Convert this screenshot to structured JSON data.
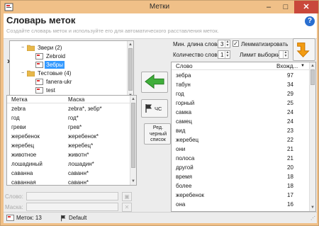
{
  "window": {
    "title": "Метки"
  },
  "header": {
    "title": "Словарь меток",
    "subtitle": "Создайте словарь меток и используйте его для автоматического расставления меток."
  },
  "tree": {
    "items": [
      {
        "label": "Звери (2)",
        "expander": "−"
      },
      {
        "label": "Zebroid"
      },
      {
        "label": "Зебры"
      },
      {
        "label": "Тестовые (4)",
        "expander": "−"
      },
      {
        "label": "fanera-ukr"
      },
      {
        "label": "test"
      }
    ]
  },
  "tags_table": {
    "headers": [
      "Метка",
      "Маска"
    ],
    "rows": [
      [
        "zebra",
        "zebra*, зебр*"
      ],
      [
        "год",
        "год*"
      ],
      [
        "греви",
        "грев*"
      ],
      [
        "жеребенок",
        "жеребенок*"
      ],
      [
        "жеребец",
        "жеребец*"
      ],
      [
        "животное",
        "животн*"
      ],
      [
        "лошадиный",
        "лошадин*"
      ],
      [
        "саванна",
        "саванн*"
      ],
      [
        "саванная",
        "саванн*"
      ]
    ]
  },
  "edit": {
    "word_label": "Слово:",
    "mask_label": "Маска:"
  },
  "buttons": {
    "add_arrow_icon": "arrow-left-green",
    "stop_label": "ЧС",
    "blacklist_label": "Ред. черный список"
  },
  "options": {
    "min_length_label": "Мин. длина слова:",
    "min_length_value": "3",
    "lemmatize_label": "Лемматизировать",
    "lemmatize_checked": true,
    "word_count_label": "Количество слов:",
    "word_count_value": "1",
    "limit_label": "Лимит выборки:",
    "limit_value": ""
  },
  "words_table": {
    "headers": [
      "Слово",
      "Вхожд..."
    ],
    "rows": [
      [
        "зебра",
        "97"
      ],
      [
        "табун",
        "34"
      ],
      [
        "год",
        "29"
      ],
      [
        "горный",
        "25"
      ],
      [
        "самка",
        "24"
      ],
      [
        "самец",
        "24"
      ],
      [
        "вид",
        "23"
      ],
      [
        "жеребец",
        "22"
      ],
      [
        "они",
        "21"
      ],
      [
        "полоса",
        "21"
      ],
      [
        "другой",
        "20"
      ],
      [
        "время",
        "18"
      ],
      [
        "более",
        "18"
      ],
      [
        "жеребенок",
        "17"
      ],
      [
        "она",
        "16"
      ]
    ]
  },
  "status": {
    "tags_count": "Меток: 13",
    "profile": "Default"
  },
  "colors": {
    "titlebar": "#f0c088",
    "selection": "#3399ff",
    "close": "#c9483b",
    "accent_orange": "#f39c12",
    "accent_green": "#3fae3a"
  }
}
